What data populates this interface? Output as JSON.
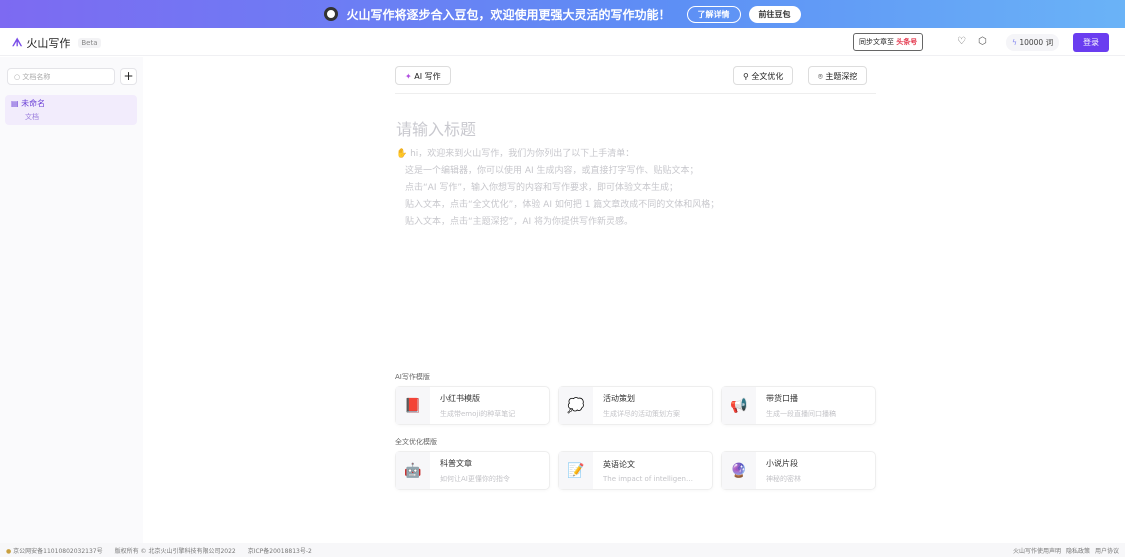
{
  "banner": {
    "text": "火山写作将逐步合入豆包，欢迎使用更强大灵活的写作功能！",
    "learn_more": "了解详情",
    "go_doubao": "前往豆包"
  },
  "header": {
    "logo": "火山写作",
    "beta": "Beta",
    "sync_prefix": "同步文章至",
    "sync_target": "头条号",
    "credits": "10000",
    "credits_unit": "词",
    "login": "登录"
  },
  "sidebar": {
    "search_placeholder": "文档名称",
    "doc_title": "未命名",
    "doc_sub": "文档"
  },
  "toolbar": {
    "ai_write": "AI 写作",
    "optimize": "全文优化",
    "explore": "主题深挖"
  },
  "editor": {
    "title_placeholder": "请输入标题",
    "lines": [
      "hi，欢迎来到火山写作，我们为你列出了以下上手清单：",
      "这是一个编辑器，你可以使用 AI 生成内容，或直接打字写作、贴贴文本；",
      "点击“AI 写作”，输入你想写的内容和写作要求，即可体验文本生成；",
      "贴入文本，点击“全文优化”，体验 AI 如何把 1 篇文章改成不同的文体和风格；",
      "贴入文本，点击“主题深挖”，AI 将为你提供写作新灵感。"
    ]
  },
  "ai_templates": {
    "label": "AI写作模版",
    "items": [
      {
        "icon": "📕",
        "title": "小红书模版",
        "desc": "生成带emoji的种草笔记"
      },
      {
        "icon": "💭",
        "title": "活动策划",
        "desc": "生成详尽的活动策划方案"
      },
      {
        "icon": "📢",
        "title": "带货口播",
        "desc": "生成一段直播间口播稿"
      }
    ]
  },
  "opt_templates": {
    "label": "全文优化模版",
    "items": [
      {
        "icon": "🤖",
        "title": "科普文章",
        "desc": "如何让AI更懂你的指令"
      },
      {
        "icon": "📝",
        "title": "英语论文",
        "desc": "The impact of intelligent hou…"
      },
      {
        "icon": "🔮",
        "title": "小说片段",
        "desc": "神秘的密林"
      }
    ]
  },
  "footer": {
    "beian": "京公网安备11010802032137号",
    "copyright": "版权所有 © 北京火山引擎科技有限公司2022",
    "icp": "京ICP备20018813号-2",
    "links": [
      "火山写作使用声明",
      "隐私政策",
      "用户协议"
    ]
  }
}
